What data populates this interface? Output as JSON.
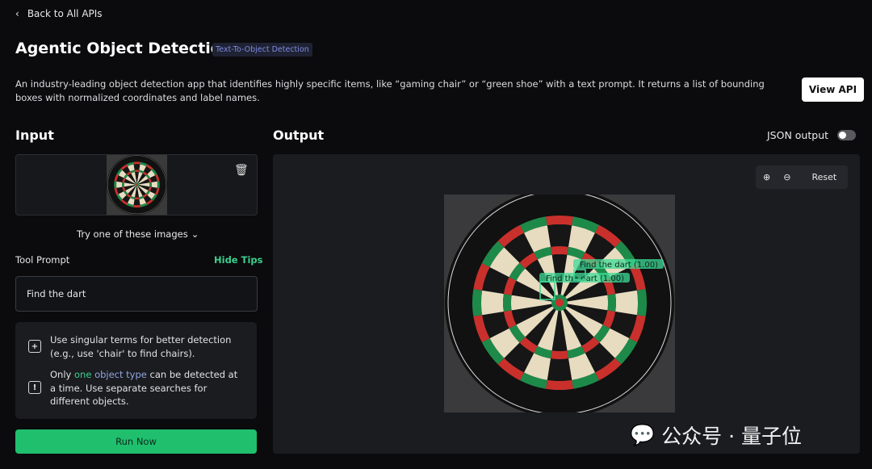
{
  "nav": {
    "back_label": "Back to All APIs"
  },
  "header": {
    "title": "Agentic Object Detection",
    "badge": "Text-To-Object Detection",
    "description": "An industry-leading object detection app that identifies highly specific items, like “gaming chair” or “green shoe” with a text prompt. It returns a list of bounding boxes with normalized coordinates and label names.",
    "view_api_label": "View API"
  },
  "input": {
    "heading": "Input",
    "try_label": "Try one of these images",
    "tool_prompt_label": "Tool Prompt",
    "hide_tips_label": "Hide Tips",
    "prompt_value": "Find the dart",
    "tips": {
      "tip1": "Use singular terms for better detection (e.g., use 'chair' to find chairs).",
      "tip2_a": "Only ",
      "tip2_hl1": "one ",
      "tip2_hl2": "object type",
      "tip2_b": " can be detected at a time. Use separate searches for different objects."
    },
    "run_label": "Run Now"
  },
  "output": {
    "heading": "Output",
    "json_toggle_label": "JSON output",
    "json_toggle_on": false,
    "reset_label": "Reset",
    "detections": [
      {
        "label": "Find the dart (1.00)"
      },
      {
        "label": "Find the dart (1.00)"
      }
    ]
  },
  "colors": {
    "accent": "#1fbf6e",
    "badge_text": "#7f8be0",
    "box": "#3ddc97"
  },
  "watermark": "公众号 · 量子位"
}
